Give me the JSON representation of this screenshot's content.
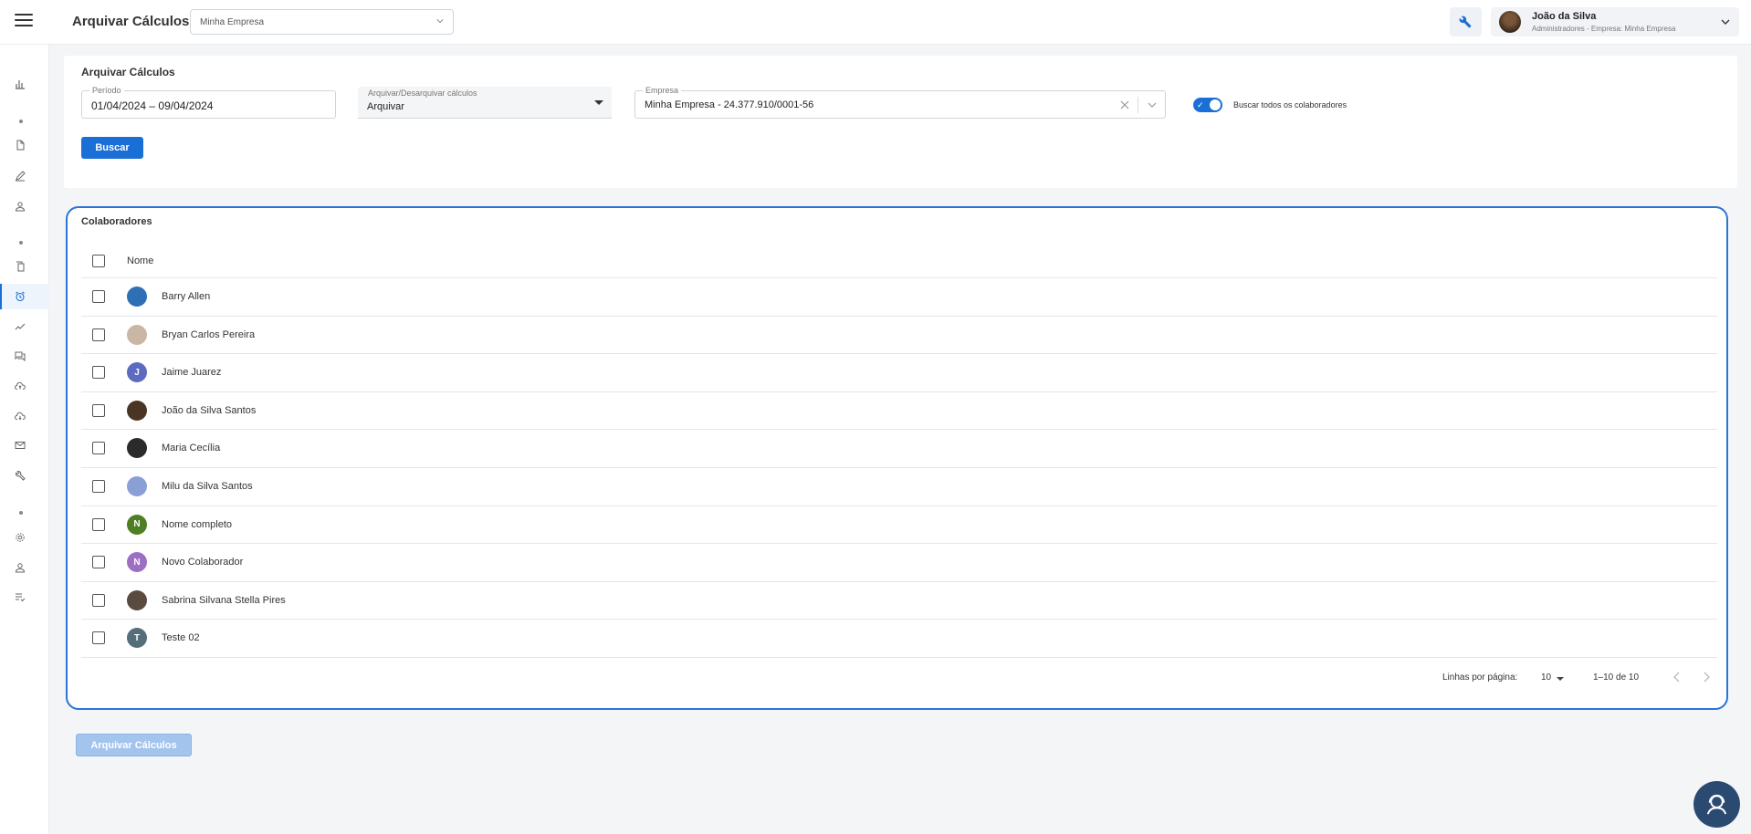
{
  "header": {
    "title": "Arquivar Cálculos",
    "company_select_value": "Minha Empresa",
    "user": {
      "name": "João da Silva",
      "role": "Administradores - Empresa: Minha Empresa"
    }
  },
  "sidebar": {
    "items": [
      {
        "icon": "chart-icon"
      },
      {
        "icon": "document-icon"
      },
      {
        "icon": "pencil-icon"
      },
      {
        "icon": "person-icon"
      },
      {
        "icon": "copy-icon"
      },
      {
        "icon": "alarm-clock-icon",
        "active": true
      },
      {
        "icon": "trend-icon"
      },
      {
        "icon": "chat-icon"
      },
      {
        "icon": "cloud-upload-icon"
      },
      {
        "icon": "cloud-download-icon"
      },
      {
        "icon": "mail-icon"
      },
      {
        "icon": "wrench-icon"
      },
      {
        "icon": "settings-icon"
      },
      {
        "icon": "user-icon"
      },
      {
        "icon": "checklist-icon"
      }
    ]
  },
  "filter": {
    "title": "Arquivar Cálculos",
    "period_label": "Período",
    "period_value": "01/04/2024 – 09/04/2024",
    "archive_label": "Arquivar/Desarquivar cálculos",
    "archive_value": "Arquivar",
    "company_label": "Empresa",
    "company_value": "Minha Empresa - 24.377.910/0001-56",
    "toggle_label": "Buscar todos os colaboradores",
    "toggle_on": true,
    "search_button": "Buscar"
  },
  "table": {
    "title": "Colaboradores",
    "column_name": "Nome",
    "rows": [
      {
        "name": "Barry Allen",
        "initial": "",
        "color": "#2f6fb5"
      },
      {
        "name": "Bryan Carlos Pereira",
        "initial": "",
        "color": "#c9b6a4"
      },
      {
        "name": "Jaime Juarez",
        "initial": "J",
        "color": "#5c6bc0"
      },
      {
        "name": "João da Silva Santos",
        "initial": "",
        "color": "#4a3524"
      },
      {
        "name": "Maria Cecília",
        "initial": "",
        "color": "#2b2b2b"
      },
      {
        "name": "Milu da Silva Santos",
        "initial": "",
        "color": "#8a9fd6"
      },
      {
        "name": "Nome completo",
        "initial": "N",
        "color": "#4f7f24"
      },
      {
        "name": "Novo Colaborador",
        "initial": "N",
        "color": "#9c6fc4"
      },
      {
        "name": "Sabrina Silvana Stella Pires",
        "initial": "",
        "color": "#5a4a40"
      },
      {
        "name": "Teste 02",
        "initial": "T",
        "color": "#546e7a"
      }
    ],
    "rows_per_page_label": "Linhas por página:",
    "rows_per_page_value": "10",
    "range_label": "1–10 de 10"
  },
  "footer": {
    "archive_button": "Arquivar Cálculos",
    "archive_button_disabled": true
  },
  "colors": {
    "accent": "#1a6fd6",
    "fab": "#2b4a72"
  }
}
